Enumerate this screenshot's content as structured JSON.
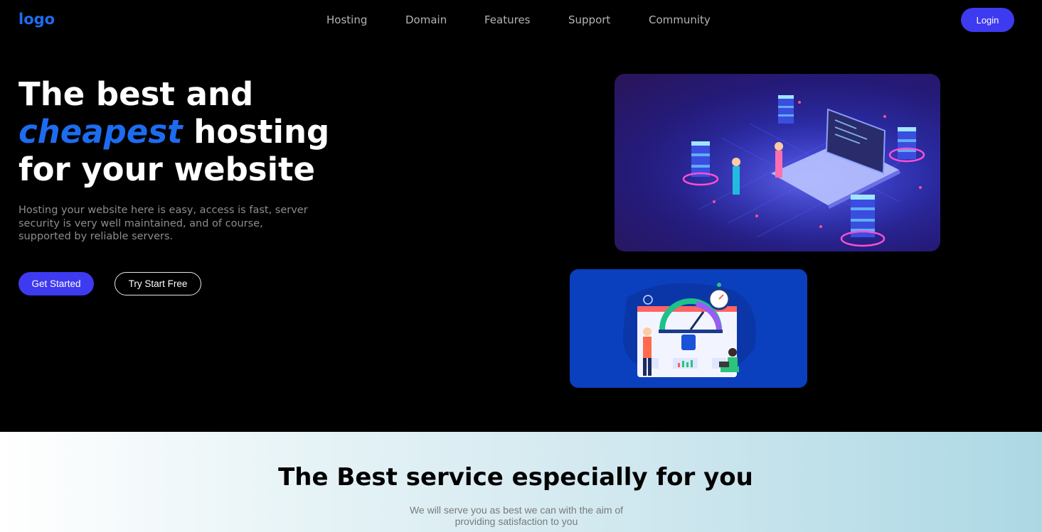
{
  "nav": {
    "logo": "logo",
    "items": [
      "Hosting",
      "Domain",
      "Features",
      "Support",
      "Community"
    ],
    "login_label": "Login"
  },
  "hero": {
    "title_line1": "The best and",
    "title_emphasis": "cheapest",
    "title_line2_rest": " hosting",
    "title_line3": "for your website",
    "description": "Hosting your website here is easy, access is fast, server security is very well maintained, and of course, supported by reliable servers.",
    "primary_button": "Get Started",
    "secondary_button": "Try Start Free"
  },
  "services": {
    "title": "The Best service especially for you",
    "description_line1": "We will serve you as best we can with the aim of",
    "description_line2": "providing satisfaction to you"
  },
  "colors": {
    "accent": "#1d6cf0",
    "button": "#3e3af0",
    "background": "#000000"
  }
}
